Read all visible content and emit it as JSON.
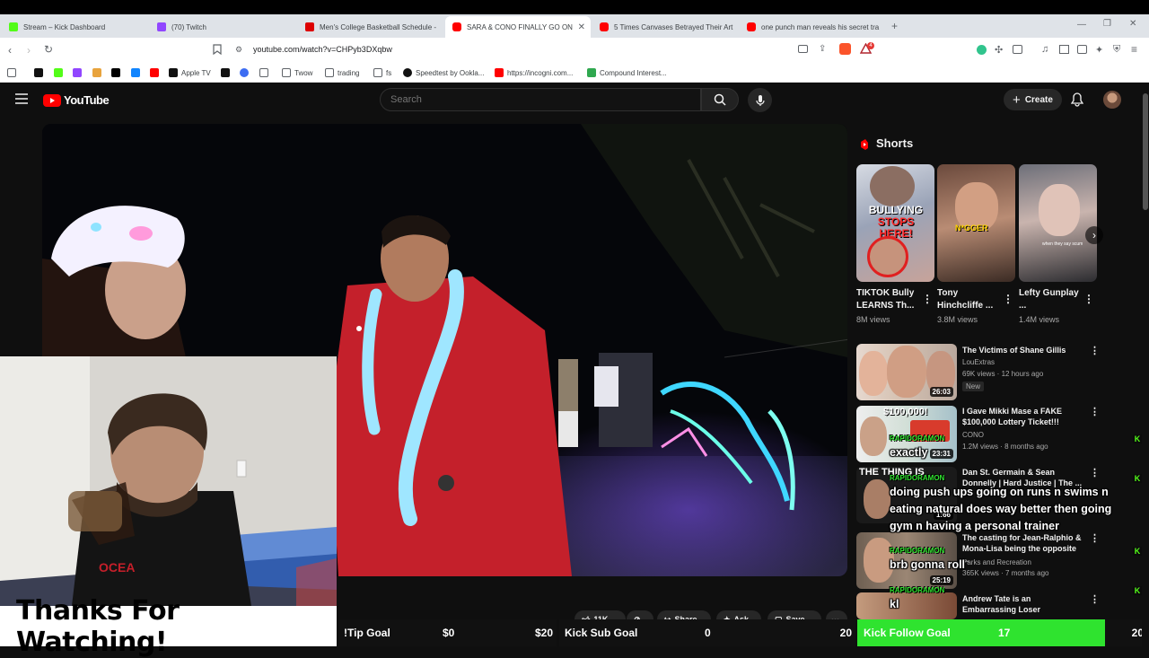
{
  "browser": {
    "tabs": [
      {
        "title": "Stream – Kick Dashboard",
        "color": "#53fc18"
      },
      {
        "title": "(70) Twitch",
        "color": "#9146ff"
      },
      {
        "title": "Men's College Basketball Schedule -",
        "color": "#d00"
      },
      {
        "title": "SARA & CONO FINALLY GO ON",
        "color": "#ff0000"
      },
      {
        "title": "5 Times Canvases Betrayed Their Art",
        "color": "#ff0000"
      },
      {
        "title": "one punch man reveals his secret tra",
        "color": "#ff0000"
      }
    ],
    "active_tab_index": 3,
    "url": "youtube.com/watch?v=CHPyb3DXqbw",
    "bookmarks": [
      {
        "label": "Apple TV"
      },
      {
        "label": "Twow"
      },
      {
        "label": "trading"
      },
      {
        "label": "fs"
      },
      {
        "label": "Speedtest by Ookla..."
      },
      {
        "label": "https://incogni.com..."
      },
      {
        "label": "Compound Interest..."
      }
    ],
    "extension_badge": "4"
  },
  "youtube": {
    "logo_text": "YouTube",
    "search_placeholder": "Search",
    "create_label": "Create"
  },
  "shorts": {
    "section_title": "Shorts",
    "items": [
      {
        "title": "TIKTOK Bully LEARNS Th...",
        "views": "8M views",
        "overlay_line1": "BULLYING",
        "overlay_line2": "STOPS HERE!"
      },
      {
        "title": "Tony Hinchcliffe ...",
        "views": "3.8M views",
        "overlay_line1": "N*GGER",
        "overlay_line2": ""
      },
      {
        "title": "Lefty Gunplay ...",
        "views": "1.4M views",
        "overlay_line1": "when they say scum",
        "overlay_line2": ""
      }
    ]
  },
  "recommendations": [
    {
      "title": "The Victims of Shane Gillis",
      "channel": "LouExtras",
      "meta": "69K views · 12 hours ago",
      "badge": "New",
      "duration": "26:03"
    },
    {
      "title": "I Gave Mikki Mase a FAKE $100,000 Lottery Ticket!!!",
      "channel": "CONO",
      "meta": "1.2M views · 8 months ago",
      "badge": "",
      "duration": "23:31",
      "thumb_text": "$100,000!"
    },
    {
      "title": "Dan St. Germain & Sean Donnelly | Hard Justice | The ...",
      "channel": "",
      "meta": "",
      "badge": "",
      "duration": "1:66",
      "thumb_text": "THE THING IS"
    },
    {
      "title": "The casting for Jean-Ralphio & Mona-Lisa being the opposite ...",
      "channel": "Parks and Recreation",
      "meta": "365K views · 7 months ago",
      "badge": "",
      "duration": "25:19"
    },
    {
      "title": "Andrew Tate is an Embarrassing Loser",
      "channel": "",
      "meta": "",
      "badge": "",
      "duration": ""
    }
  ],
  "chat": [
    {
      "user": "RAPIDORAMON",
      "message": "exactly"
    },
    {
      "user": "RAPIDORAMON",
      "message": "doing push ups going on runs n swims n eating natural does way better then going gym n having a personal trainer"
    },
    {
      "user": "RAPIDORAMON",
      "message": "brb gonna roll"
    },
    {
      "user": "RAPIDORAMON",
      "message": "kl"
    }
  ],
  "video_actions": {
    "likes": "11K",
    "share": "Share",
    "ask": "Ask",
    "save": "Save"
  },
  "overlays": {
    "thanks_text": "Thanks For Watching!",
    "tip_goal": {
      "label": "!Tip Goal",
      "current": "$0",
      "target": "$20"
    },
    "sub_goal": {
      "label": "Kick Sub Goal",
      "current": "0",
      "target": "20"
    },
    "follow_goal": {
      "label": "Kick Follow Goal",
      "current": "17",
      "target": "20",
      "progress": 0.85,
      "color": "#2fe32f"
    }
  },
  "colors": {
    "youtube_red": "#ff0000",
    "kick_green": "#53fc18",
    "background": "#0f0f0f"
  }
}
